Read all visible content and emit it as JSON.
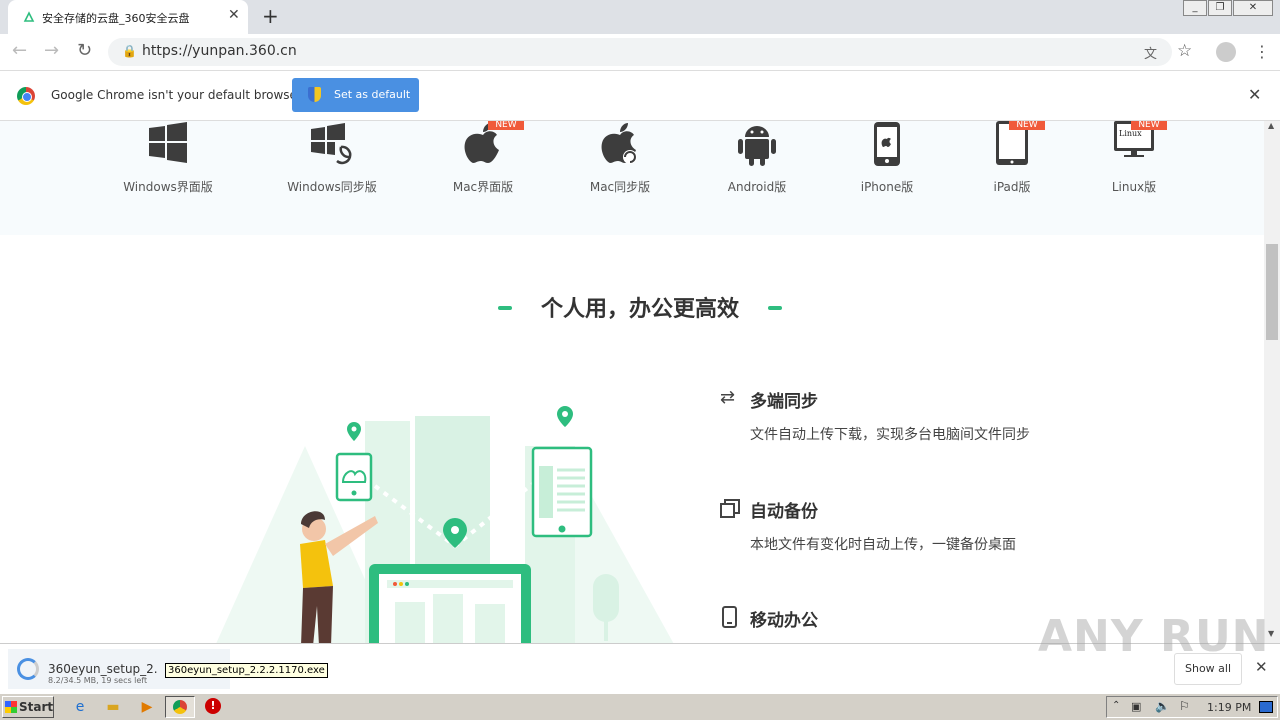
{
  "browser": {
    "tab_title": "安全存储的云盘_360安全云盘",
    "tab_close": "✕",
    "new_tab": "+",
    "window_buttons": [
      "_",
      "❐",
      "✕"
    ],
    "url": "https://yunpan.360.cn"
  },
  "infobar": {
    "message": "Google Chrome isn't your default browser",
    "button_label": "Set as default",
    "close": "✕"
  },
  "platforms": [
    {
      "label": "Windows界面版",
      "icon": "windows-icon",
      "new": false
    },
    {
      "label": "Windows同步版",
      "icon": "windows-sync-icon",
      "new": false
    },
    {
      "label": "Mac界面版",
      "icon": "apple-icon",
      "new": true
    },
    {
      "label": "Mac同步版",
      "icon": "apple-sync-icon",
      "new": false
    },
    {
      "label": "Android版",
      "icon": "android-icon",
      "new": false
    },
    {
      "label": "iPhone版",
      "icon": "iphone-icon",
      "new": false
    },
    {
      "label": "iPad版",
      "icon": "ipad-icon",
      "new": true
    },
    {
      "label": "Linux版",
      "icon": "linux-monitor-icon",
      "new": true
    }
  ],
  "new_badge": "NEW",
  "linux_screen_text": "Linux",
  "section_title": "个人用，办公更高效",
  "features": [
    {
      "icon": "sync-arrows-icon",
      "title": "多端同步",
      "desc": "文件自动上传下载，实现多台电脑间文件同步"
    },
    {
      "icon": "copy-backup-icon",
      "title": "自动备份",
      "desc": "本地文件有变化时自动上传，一键备份桌面"
    },
    {
      "icon": "mobile-icon",
      "title": "移动办公",
      "desc": ""
    }
  ],
  "download": {
    "filename": "360eyun_setup_2.",
    "status": "8.2/34.5 MB, 19 secs left",
    "tooltip": "360eyun_setup_2.2.2.1170.exe",
    "show_all": "Show all",
    "close": "✕"
  },
  "watermark": "ANY RUN",
  "taskbar": {
    "start": "Start",
    "clock": "1:19 PM"
  },
  "colors": {
    "accent": "#2ebd7f",
    "badge": "#f05a3a",
    "set_default": "#4a90e2"
  }
}
